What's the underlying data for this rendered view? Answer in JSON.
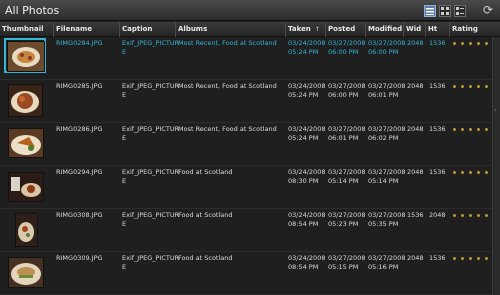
{
  "app": {
    "title": "All Photos"
  },
  "toolbar": {
    "view_buttons": [
      {
        "icon": "list-view-icon",
        "active": true
      },
      {
        "icon": "grid-view-icon",
        "active": false
      },
      {
        "icon": "detail-view-icon",
        "active": false
      }
    ],
    "refresh_icon": "refresh-icon"
  },
  "columns": {
    "thumbnail": "Thumbnail",
    "filename": "Filename",
    "caption": "Caption",
    "albums": "Albums",
    "taken": "Taken",
    "taken_sort": "↑",
    "posted": "Posted",
    "modified": "Modified",
    "wid": "Wid",
    "ht": "Ht",
    "rating": "Rating"
  },
  "rows": [
    {
      "filename": "RIMG0284.JPG",
      "caption": "Exif_JPEG_PICTUR\nE",
      "albums": "Most Recent, Food at Scotland",
      "taken": "03/24/2008\n05:24 PM",
      "posted": "03/27/2008\n06:00 PM",
      "modified": "03/27/2008\n06:00 PM",
      "wid": "2048",
      "ht": "1536",
      "selected": true,
      "rating": 5
    },
    {
      "filename": "RIMG0285.JPG",
      "caption": "Exif_JPEG_PICTUR\nE",
      "albums": "Most Recent, Food at Scotland",
      "taken": "03/24/2008\n05:24 PM",
      "posted": "03/27/2008\n06:00 PM",
      "modified": "03/27/2008\n06:01 PM",
      "wid": "2048",
      "ht": "1536",
      "selected": false,
      "rating": 5
    },
    {
      "filename": "RIMG0286.JPG",
      "caption": "Exif_JPEG_PICTUR\nE",
      "albums": "Most Recent, Food at Scotland",
      "taken": "03/24/2008\n05:24 PM",
      "posted": "03/27/2008\n06:01 PM",
      "modified": "03/27/2008\n06:02 PM",
      "wid": "2048",
      "ht": "1536",
      "selected": false,
      "rating": 5
    },
    {
      "filename": "RIMG0294.JPG",
      "caption": "Exif_JPEG_PICTUR\nE",
      "albums": "Food at Scotland",
      "taken": "03/24/2008\n08:30 PM",
      "posted": "03/27/2008\n05:14 PM",
      "modified": "03/27/2008\n05:14 PM",
      "wid": "2048",
      "ht": "1536",
      "selected": false,
      "rating": 5
    },
    {
      "filename": "RIMG0308.JPG",
      "caption": "Exif_JPEG_PICTUR\nE",
      "albums": "Food at Scotland",
      "taken": "03/24/2008\n08:54 PM",
      "posted": "03/27/2008\n05:23 PM",
      "modified": "03/27/2008\n05:35 PM",
      "wid": "1536",
      "ht": "2048",
      "selected": false,
      "rating": 5
    },
    {
      "filename": "RIMG0309.JPG",
      "caption": "Exif_JPEG_PICTUR\nE",
      "albums": "Food at Scotland",
      "taken": "03/24/2008\n08:54 PM",
      "posted": "03/27/2008\n05:15 PM",
      "modified": "03/27/2008\n05:16 PM",
      "wid": "2048",
      "ht": "1536",
      "selected": false,
      "rating": 5
    }
  ],
  "colors": {
    "accent": "#35b6d8",
    "star": "#b8952e",
    "background": "#1f1f1f"
  }
}
